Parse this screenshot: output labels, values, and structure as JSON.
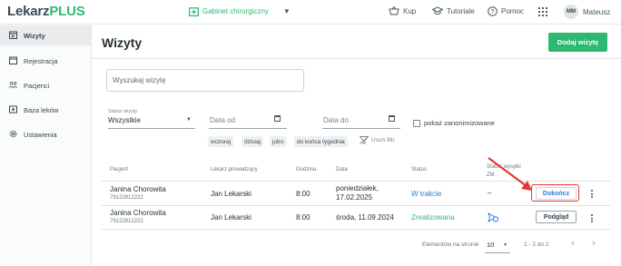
{
  "app": {
    "logo_part1": "Lekarz",
    "logo_part2": "PLUS"
  },
  "topbar": {
    "clinic": "Gabinet chirurgiczny",
    "shop_label": "Kup",
    "tutorials_label": "Tutoriale",
    "help_label": "Pomoc",
    "avatar_initials": "MM",
    "user_name": "Mateusz"
  },
  "sidebar": {
    "items": [
      {
        "label": "Wizyty",
        "icon": "calendar-check-icon",
        "active": true
      },
      {
        "label": "Rejestracja",
        "icon": "calendar-icon",
        "active": false
      },
      {
        "label": "Pacjenci",
        "icon": "people-icon",
        "active": false
      },
      {
        "label": "Baza leków",
        "icon": "medicine-box-icon",
        "active": false
      },
      {
        "label": "Ustawienia",
        "icon": "gear-icon",
        "active": false
      }
    ]
  },
  "page": {
    "title": "Wizyty",
    "add_button": "Dodaj wizytę"
  },
  "filters": {
    "search_placeholder": "Wyszukaj wizytę",
    "status_label": "Status wizyty",
    "status_value": "Wszystkie",
    "date_from_placeholder": "Data od",
    "date_to_placeholder": "Data do",
    "show_anonymized": "pokaż zanonimizowane",
    "chips": [
      "wczoraj",
      "dzisiaj",
      "jutro",
      "do końca tygodnia"
    ],
    "clear": "Usuń filtr"
  },
  "table": {
    "headers": {
      "patient": "Pacjent",
      "doctor": "Lekarz prowadzący",
      "time": "Godzina",
      "date": "Data",
      "status": "Status",
      "zm_status": "Status wysyłki ZM"
    },
    "rows": [
      {
        "patient": "Janina Chorowita",
        "phone": "79122812222",
        "doctor": "Jan Lekarski",
        "time": "8:00",
        "date_line1": "poniedziałek,",
        "date_line2": "17.02.2025",
        "status": "W trakcie",
        "zm": "–",
        "action": "Dokończ"
      },
      {
        "patient": "Janina Chorowita",
        "phone": "79122812222",
        "doctor": "Jan Lekarski",
        "time": "8:00",
        "date_line1": "środa, 11.09.2024",
        "status": "Zrealizowana",
        "zm_icon": "sent-status-icon",
        "action": "Podgląd"
      }
    ]
  },
  "pagination": {
    "per_page_label": "Elementów na stronie",
    "per_page_value": "10",
    "range": "1 - 2 do 2"
  },
  "colors": {
    "brand_green": "#2eb872",
    "link_blue": "#2f7ad8",
    "highlight_red": "#e83636"
  }
}
